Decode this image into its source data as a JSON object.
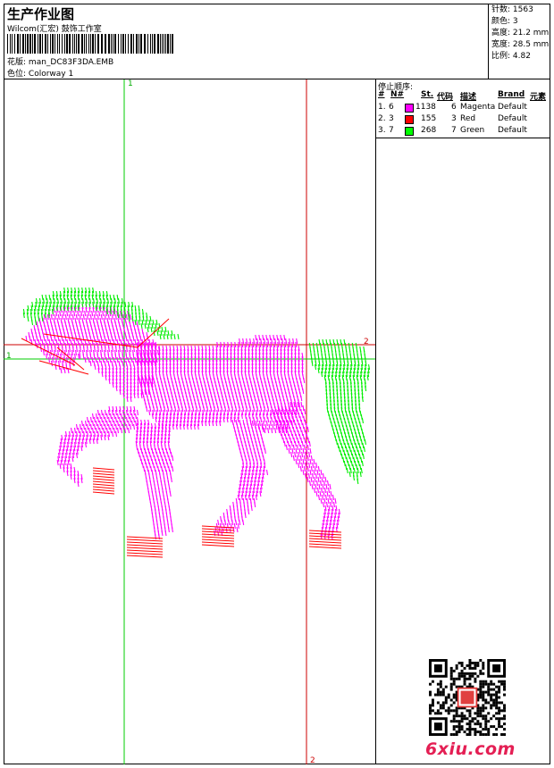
{
  "header": {
    "title": "生产作业图",
    "company": "Wilcom(汇宏) 鼓饰工作室",
    "design_label": "花版:",
    "design_value": "man_DC83F3DA.EMB",
    "colorway_label": "色位:",
    "colorway_value": "Colorway 1"
  },
  "stats": {
    "stitches": "针数: 1563",
    "colors": "颜色: 3",
    "height": "高度: 21.2 mm",
    "width": "宽度: 28.5 mm",
    "scale": "比例: 4.82"
  },
  "stop_sequence": {
    "title": "停止顺序:",
    "columns": [
      "#",
      "N#",
      "St.",
      "代码",
      "描述",
      "Brand",
      "元素"
    ],
    "rows": [
      {
        "idx": "1.",
        "n": "6",
        "color": "#ff00ff",
        "st": "1138",
        "code": "6",
        "desc": "Magenta",
        "brand": "Default"
      },
      {
        "idx": "2.",
        "n": "3",
        "color": "#ff0000",
        "st": "155",
        "code": "3",
        "desc": "Red",
        "brand": "Default"
      },
      {
        "idx": "3.",
        "n": "7",
        "color": "#00ff00",
        "st": "268",
        "code": "7",
        "desc": "Green",
        "brand": "Default"
      }
    ]
  },
  "guides": {
    "v1": "1",
    "v2": "2",
    "h1": "1",
    "h2": "2"
  },
  "colors": {
    "magenta": "#ff00ff",
    "red": "#ff0000",
    "green": "#00ff00",
    "guide_green": "#00cc00",
    "guide_red": "#cc0000"
  },
  "watermark": "6xiu.com"
}
